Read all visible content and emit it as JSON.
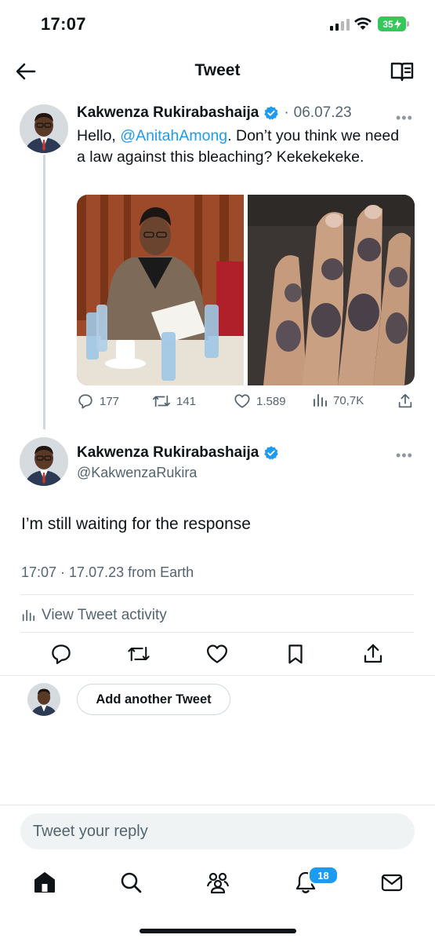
{
  "status_bar": {
    "time": "17:07",
    "battery": "35"
  },
  "nav": {
    "title": "Tweet",
    "back_icon": "arrow-left-icon",
    "reader_icon": "book-open-icon"
  },
  "parent_tweet": {
    "author_name": "Kakwenza Rukirabashaija",
    "date": "06.07.23",
    "text_before_mention": "Hello, ",
    "mention": "@AnitahAmong",
    "text_after_mention": ". Don’t you think we need a law against this bleaching? Kekekekeke.",
    "stats": {
      "replies": "177",
      "retweets": "141",
      "likes": "1.589",
      "views": "70,7K"
    }
  },
  "main_tweet": {
    "author_name": "Kakwenza Rukirabashaija",
    "handle": "@KakwenzaRukira",
    "text": "I’m still waiting for the response",
    "time": "17:07",
    "separator": " · ",
    "date": "17.07.23",
    "source": " from Earth",
    "view_activity": "View Tweet activity"
  },
  "reply": {
    "add_button": "Add another Tweet",
    "placeholder": "Tweet your reply"
  },
  "tabbar": {
    "notifications_badge": "18"
  },
  "colors": {
    "accent": "#1d9bf0",
    "muted": "#536471",
    "battery": "#34c759"
  }
}
